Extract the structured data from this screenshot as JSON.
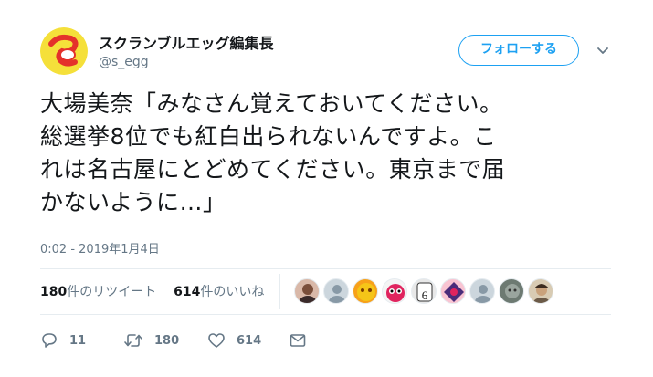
{
  "tweet": {
    "author_name": "スクランブルエッグ編集長",
    "author_handle": "@s_egg",
    "follow_label": "フォローする",
    "text_lines": [
      "大場美奈「みなさん覚えておいてください。",
      "総選挙8位でも紅白出られないんですよ。こ",
      "れは名古屋にとどめてください。東京まで届",
      "かないように…」"
    ],
    "timestamp": "0:02 - 2019年1月4日",
    "stats": {
      "retweets_count": "180",
      "retweets_label": "件のリツイート",
      "likes_count": "614",
      "likes_label": "件のいいね"
    },
    "actions": {
      "reply_count": "11",
      "retweet_count": "180",
      "like_count": "614"
    },
    "accent_color": "#1da1f2"
  },
  "likers": [
    "liker-avatar-1",
    "liker-avatar-2",
    "liker-avatar-3",
    "liker-avatar-4",
    "liker-avatar-5",
    "liker-avatar-6",
    "liker-avatar-7",
    "liker-avatar-8",
    "liker-avatar-9"
  ]
}
